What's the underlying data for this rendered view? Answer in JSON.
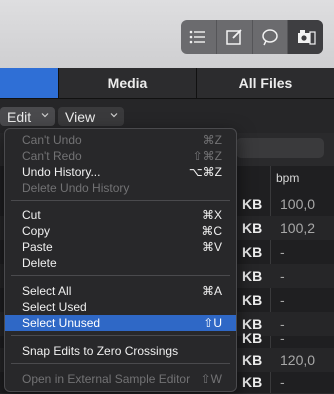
{
  "toolbar": {
    "icons": [
      "list-icon",
      "notepad-icon",
      "loop-icon",
      "media-browser-icon"
    ]
  },
  "tabs": [
    {
      "label": ""
    },
    {
      "label": "Media"
    },
    {
      "label": "All Files"
    }
  ],
  "editbar": {
    "edit_label": "Edit",
    "view_label": "View"
  },
  "table": {
    "bpm_header": "bpm",
    "rows": [
      {
        "size": "KB",
        "bpm": "100,0"
      },
      {
        "size": "KB",
        "bpm": "100,2"
      },
      {
        "size": "KB",
        "bpm": "-"
      },
      {
        "size": "KB",
        "bpm": "-"
      },
      {
        "size": "KB",
        "bpm": "-"
      },
      {
        "size": "KB",
        "bpm": "-"
      },
      {
        "size": "KB",
        "bpm": "-"
      },
      {
        "size": "KB",
        "bpm": "120,0"
      },
      {
        "size": "KB",
        "bpm": "-"
      }
    ]
  },
  "menu": {
    "items": [
      {
        "label": "Can't Undo",
        "shortcut": "⌘Z",
        "state": "disabled"
      },
      {
        "label": "Can't Redo",
        "shortcut": "⇧⌘Z",
        "state": "disabled"
      },
      {
        "label": "Undo History...",
        "shortcut": "⌥⌘Z",
        "state": "enabled"
      },
      {
        "label": "Delete Undo History",
        "shortcut": "",
        "state": "disabled"
      },
      {
        "label": "Cut",
        "shortcut": "⌘X",
        "state": "enabled"
      },
      {
        "label": "Copy",
        "shortcut": "⌘C",
        "state": "enabled"
      },
      {
        "label": "Paste",
        "shortcut": "⌘V",
        "state": "enabled"
      },
      {
        "label": "Delete",
        "shortcut": "",
        "state": "enabled"
      },
      {
        "label": "Select All",
        "shortcut": "⌘A",
        "state": "enabled"
      },
      {
        "label": "Select Used",
        "shortcut": "",
        "state": "enabled"
      },
      {
        "label": "Select Unused",
        "shortcut": "⇧U",
        "state": "selected"
      },
      {
        "label": "Snap Edits to Zero Crossings",
        "shortcut": "",
        "state": "enabled"
      },
      {
        "label": "Open in External Sample Editor",
        "shortcut": "⇧W",
        "state": "disabled"
      }
    ]
  },
  "colors": {
    "accent": "#2f6fd6",
    "menu_highlight": "#2f68c6"
  }
}
